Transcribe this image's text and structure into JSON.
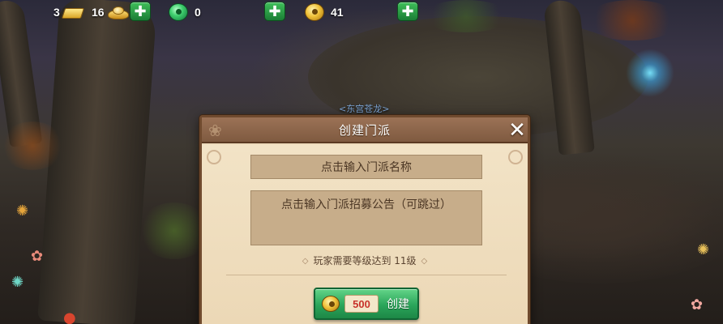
{
  "resources": {
    "gold_bar_count": "3",
    "ingot_count": "16",
    "jade_count": "0",
    "coin_count": "41"
  },
  "npc_name": "<东宫苍龙>",
  "dialog": {
    "title": "创建门派",
    "name_placeholder": "点击输入门派名称",
    "notice_placeholder": "点击输入门派招募公告（可跳过）",
    "requirement": "玩家需要等级达到 11级",
    "create_cost": "500",
    "create_label": "创建"
  },
  "icons": {
    "close": "close-icon",
    "add": "plus-icon",
    "currency": [
      "gold-bar-icon",
      "ingot-icon",
      "jade-icon",
      "coin-icon"
    ]
  },
  "colors": {
    "dialog_bg": "#eedcbd",
    "header_bg": "#8a6549",
    "button_green": "#2aa55a",
    "cost_red": "#c8322b"
  }
}
